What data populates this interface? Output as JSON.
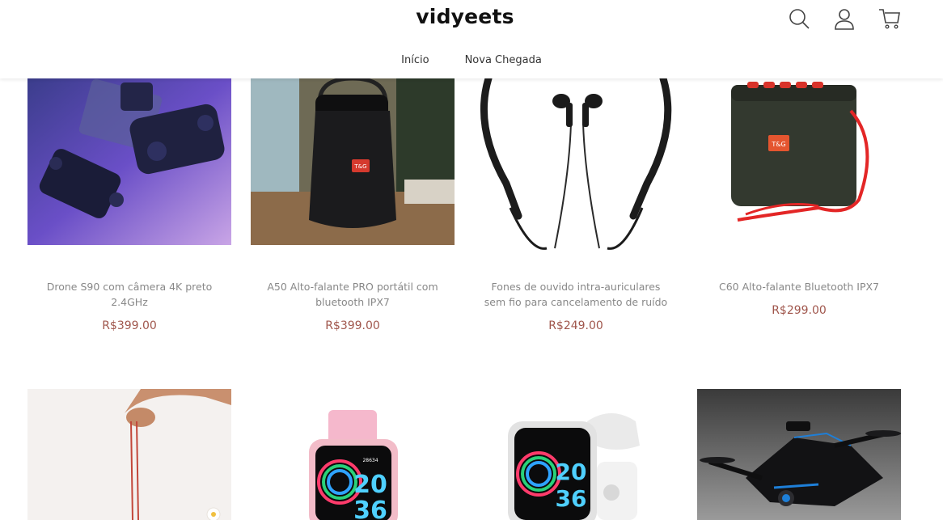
{
  "header": {
    "logo": "vidyeets",
    "nav": [
      {
        "label": "Início"
      },
      {
        "label": "Nova Chegada"
      }
    ],
    "icons": [
      "search-icon",
      "user-icon",
      "cart-icon"
    ]
  },
  "colors": {
    "price": "#a0564c",
    "title": "#888888",
    "background": "#ffffff"
  },
  "products": [
    {
      "title": "Drone S90 com câmera 4K preto 2.4GHz",
      "price": "R$399.00",
      "image": "drone-controller-image"
    },
    {
      "title": "A50 Alto-falante PRO portátil com bluetooth IPX7",
      "price": "R$399.00",
      "image": "black-speaker-image"
    },
    {
      "title": "Fones de ouvido intra-auriculares sem fio para cancelamento de ruído",
      "price": "R$249.00",
      "image": "neckband-earphones-image"
    },
    {
      "title": "C60 Alto-falante Bluetooth IPX7",
      "price": "R$299.00",
      "image": "green-speaker-image"
    },
    {
      "title": "",
      "price": "",
      "image": "lanyard-hand-image"
    },
    {
      "title": "",
      "price": "",
      "image": "pink-smartwatch-image"
    },
    {
      "title": "",
      "price": "",
      "image": "white-smartwatch-image"
    },
    {
      "title": "",
      "price": "",
      "image": "black-drone-image"
    }
  ]
}
